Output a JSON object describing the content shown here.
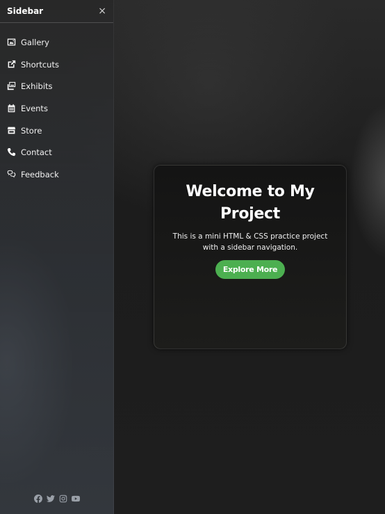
{
  "sidebar": {
    "title": "Sidebar",
    "close_symbol": "×",
    "items": [
      {
        "label": "Gallery",
        "icon": "image-icon"
      },
      {
        "label": "Shortcuts",
        "icon": "external-link-icon"
      },
      {
        "label": "Exhibits",
        "icon": "images-icon"
      },
      {
        "label": "Events",
        "icon": "calendar-icon"
      },
      {
        "label": "Store",
        "icon": "store-icon"
      },
      {
        "label": "Contact",
        "icon": "phone-icon"
      },
      {
        "label": "Feedback",
        "icon": "comments-icon"
      }
    ],
    "social": [
      "facebook-icon",
      "twitter-icon",
      "instagram-icon",
      "youtube-icon"
    ]
  },
  "card": {
    "title": "Welcome to My Project",
    "description": "This is a mini HTML & CSS practice project with a sidebar navigation.",
    "button_label": "Explore More"
  },
  "colors": {
    "accent": "#4caf50"
  }
}
